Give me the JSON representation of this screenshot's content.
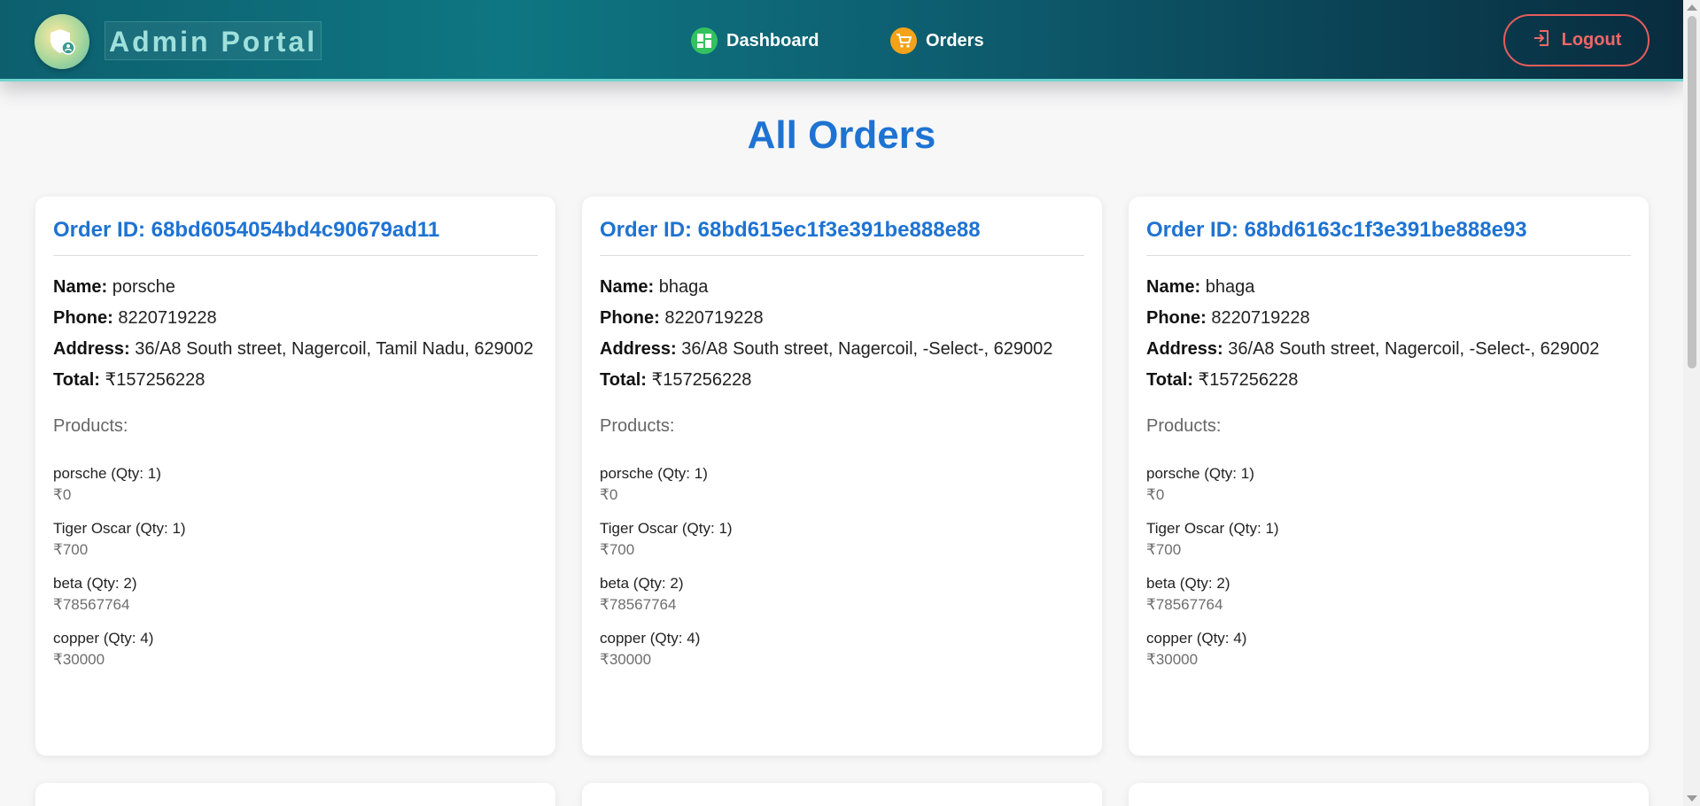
{
  "header": {
    "brand": "Admin Portal",
    "nav": [
      {
        "label": "Dashboard",
        "icon": "dashboard-grid-icon"
      },
      {
        "label": "Orders",
        "icon": "cart-icon"
      }
    ],
    "logout_label": "Logout"
  },
  "page_title": "All Orders",
  "orders": [
    {
      "id_text": "Order ID: 68bd6054054bd4c90679ad11",
      "name_label": "Name:",
      "name": "porsche",
      "phone_label": "Phone:",
      "phone": "8220719228",
      "address_label": "Address:",
      "address": "36/A8 South street, Nagercoil, Tamil Nadu, 629002",
      "total_label": "Total:",
      "total": "₹157256228",
      "products_label": "Products:",
      "products": [
        {
          "name": "porsche (Qty: 1)",
          "price": "₹0"
        },
        {
          "name": "Tiger Oscar (Qty: 1)",
          "price": "₹700"
        },
        {
          "name": "beta (Qty: 2)",
          "price": "₹78567764"
        },
        {
          "name": "copper (Qty: 4)",
          "price": "₹30000"
        }
      ]
    },
    {
      "id_text": "Order ID: 68bd615ec1f3e391be888e88",
      "name_label": "Name:",
      "name": "bhaga",
      "phone_label": "Phone:",
      "phone": "8220719228",
      "address_label": "Address:",
      "address": "36/A8 South street, Nagercoil, -Select-, 629002",
      "total_label": "Total:",
      "total": "₹157256228",
      "products_label": "Products:",
      "products": [
        {
          "name": "porsche (Qty: 1)",
          "price": "₹0"
        },
        {
          "name": "Tiger Oscar (Qty: 1)",
          "price": "₹700"
        },
        {
          "name": "beta (Qty: 2)",
          "price": "₹78567764"
        },
        {
          "name": "copper (Qty: 4)",
          "price": "₹30000"
        }
      ]
    },
    {
      "id_text": "Order ID: 68bd6163c1f3e391be888e93",
      "name_label": "Name:",
      "name": "bhaga",
      "phone_label": "Phone:",
      "phone": "8220719228",
      "address_label": "Address:",
      "address": "36/A8 South street, Nagercoil, -Select-, 629002",
      "total_label": "Total:",
      "total": "₹157256228",
      "products_label": "Products:",
      "products": [
        {
          "name": "porsche (Qty: 1)",
          "price": "₹0"
        },
        {
          "name": "Tiger Oscar (Qty: 1)",
          "price": "₹700"
        },
        {
          "name": "beta (Qty: 2)",
          "price": "₹78567764"
        },
        {
          "name": "copper (Qty: 4)",
          "price": "₹30000"
        }
      ]
    }
  ],
  "colors": {
    "accent": "#1e73d2",
    "logout": "#e85c5c",
    "dashboard_icon": "#34c160",
    "orders_icon": "#f3a21a"
  }
}
